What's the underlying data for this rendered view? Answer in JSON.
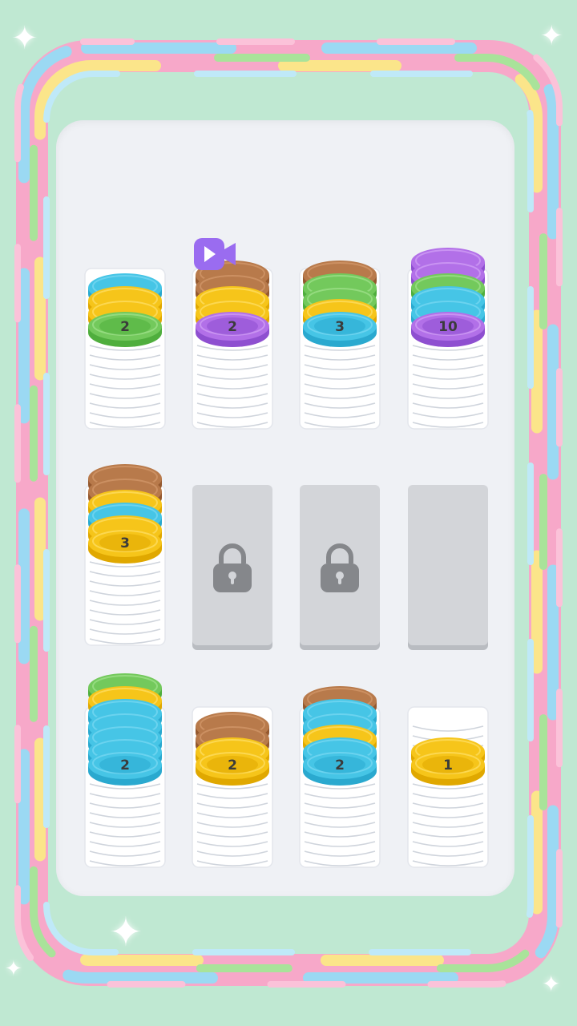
{
  "game": {
    "title": "",
    "colors": {
      "blue": "#46c5e6",
      "yellow": "#f6c51a",
      "green": "#73c95c",
      "brown": "#b87a4b",
      "purple": "#b270e8",
      "empty_ring": "#f4f6fa",
      "locked": "#d3d5d9",
      "video": "#9a6cf0"
    },
    "slots": [
      {
        "state": "stack",
        "coins": [
          "green",
          "yellow",
          "yellow",
          "blue"
        ],
        "top_count": "2"
      },
      {
        "state": "stack",
        "coins": [
          "purple",
          "yellow",
          "yellow",
          "brown",
          "brown"
        ],
        "top_count": "2",
        "video_icon": true
      },
      {
        "state": "stack",
        "coins": [
          "blue",
          "yellow",
          "green",
          "green",
          "brown"
        ],
        "top_count": "3"
      },
      {
        "state": "stack",
        "coins": [
          "purple",
          "blue",
          "blue",
          "green",
          "purple",
          "purple"
        ],
        "top_count": "10"
      },
      {
        "state": "stack",
        "coins": [
          "yellow",
          "yellow",
          "blue",
          "yellow",
          "brown",
          "brown"
        ],
        "top_count": "3"
      },
      {
        "state": "locked",
        "icon": "lock-icon"
      },
      {
        "state": "locked",
        "icon": "lock-icon"
      },
      {
        "state": "empty"
      },
      {
        "state": "stack",
        "coins": [
          "blue",
          "blue",
          "blue",
          "blue",
          "blue",
          "yellow",
          "green"
        ],
        "top_count": "2"
      },
      {
        "state": "stack",
        "coins": [
          "yellow",
          "yellow",
          "brown",
          "brown"
        ],
        "top_count": "2"
      },
      {
        "state": "stack",
        "coins": [
          "blue",
          "blue",
          "yellow",
          "blue",
          "blue",
          "brown"
        ],
        "top_count": "2"
      },
      {
        "state": "stack",
        "coins": [
          "yellow",
          "yellow"
        ],
        "top_count": "1"
      }
    ],
    "icons": [
      "lock-icon",
      "video-icon",
      "sparkle-icon"
    ]
  }
}
